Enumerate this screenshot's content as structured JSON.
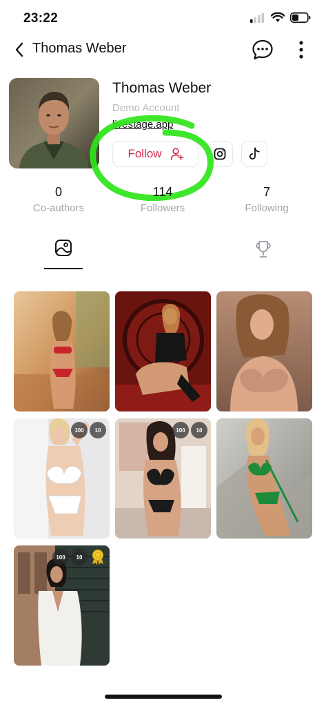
{
  "status": {
    "time": "23:22"
  },
  "nav": {
    "title": "Thomas Weber"
  },
  "profile": {
    "name": "Thomas Weber",
    "subtitle": "Demo Account",
    "link": "livestage.app",
    "follow_label": "Follow"
  },
  "stats": [
    {
      "value": "0",
      "label": "Co-authors"
    },
    {
      "value": "114",
      "label": "Followers"
    },
    {
      "value": "7",
      "label": "Following"
    }
  ],
  "tabs": [
    {
      "icon": "image-icon",
      "active": true
    },
    {
      "icon": "trophy-icon",
      "active": false
    }
  ],
  "posts": [
    {
      "badges": []
    },
    {
      "badges": []
    },
    {
      "badges": []
    },
    {
      "badges": [
        "100",
        "10"
      ]
    },
    {
      "badges": [
        "100",
        "10"
      ]
    },
    {
      "badges": []
    },
    {
      "badges": [
        "100",
        "10"
      ],
      "award": true
    }
  ],
  "colors": {
    "accent": "#d3264a",
    "highlight": "#2ee51a",
    "muted": "#a3a3ab"
  }
}
